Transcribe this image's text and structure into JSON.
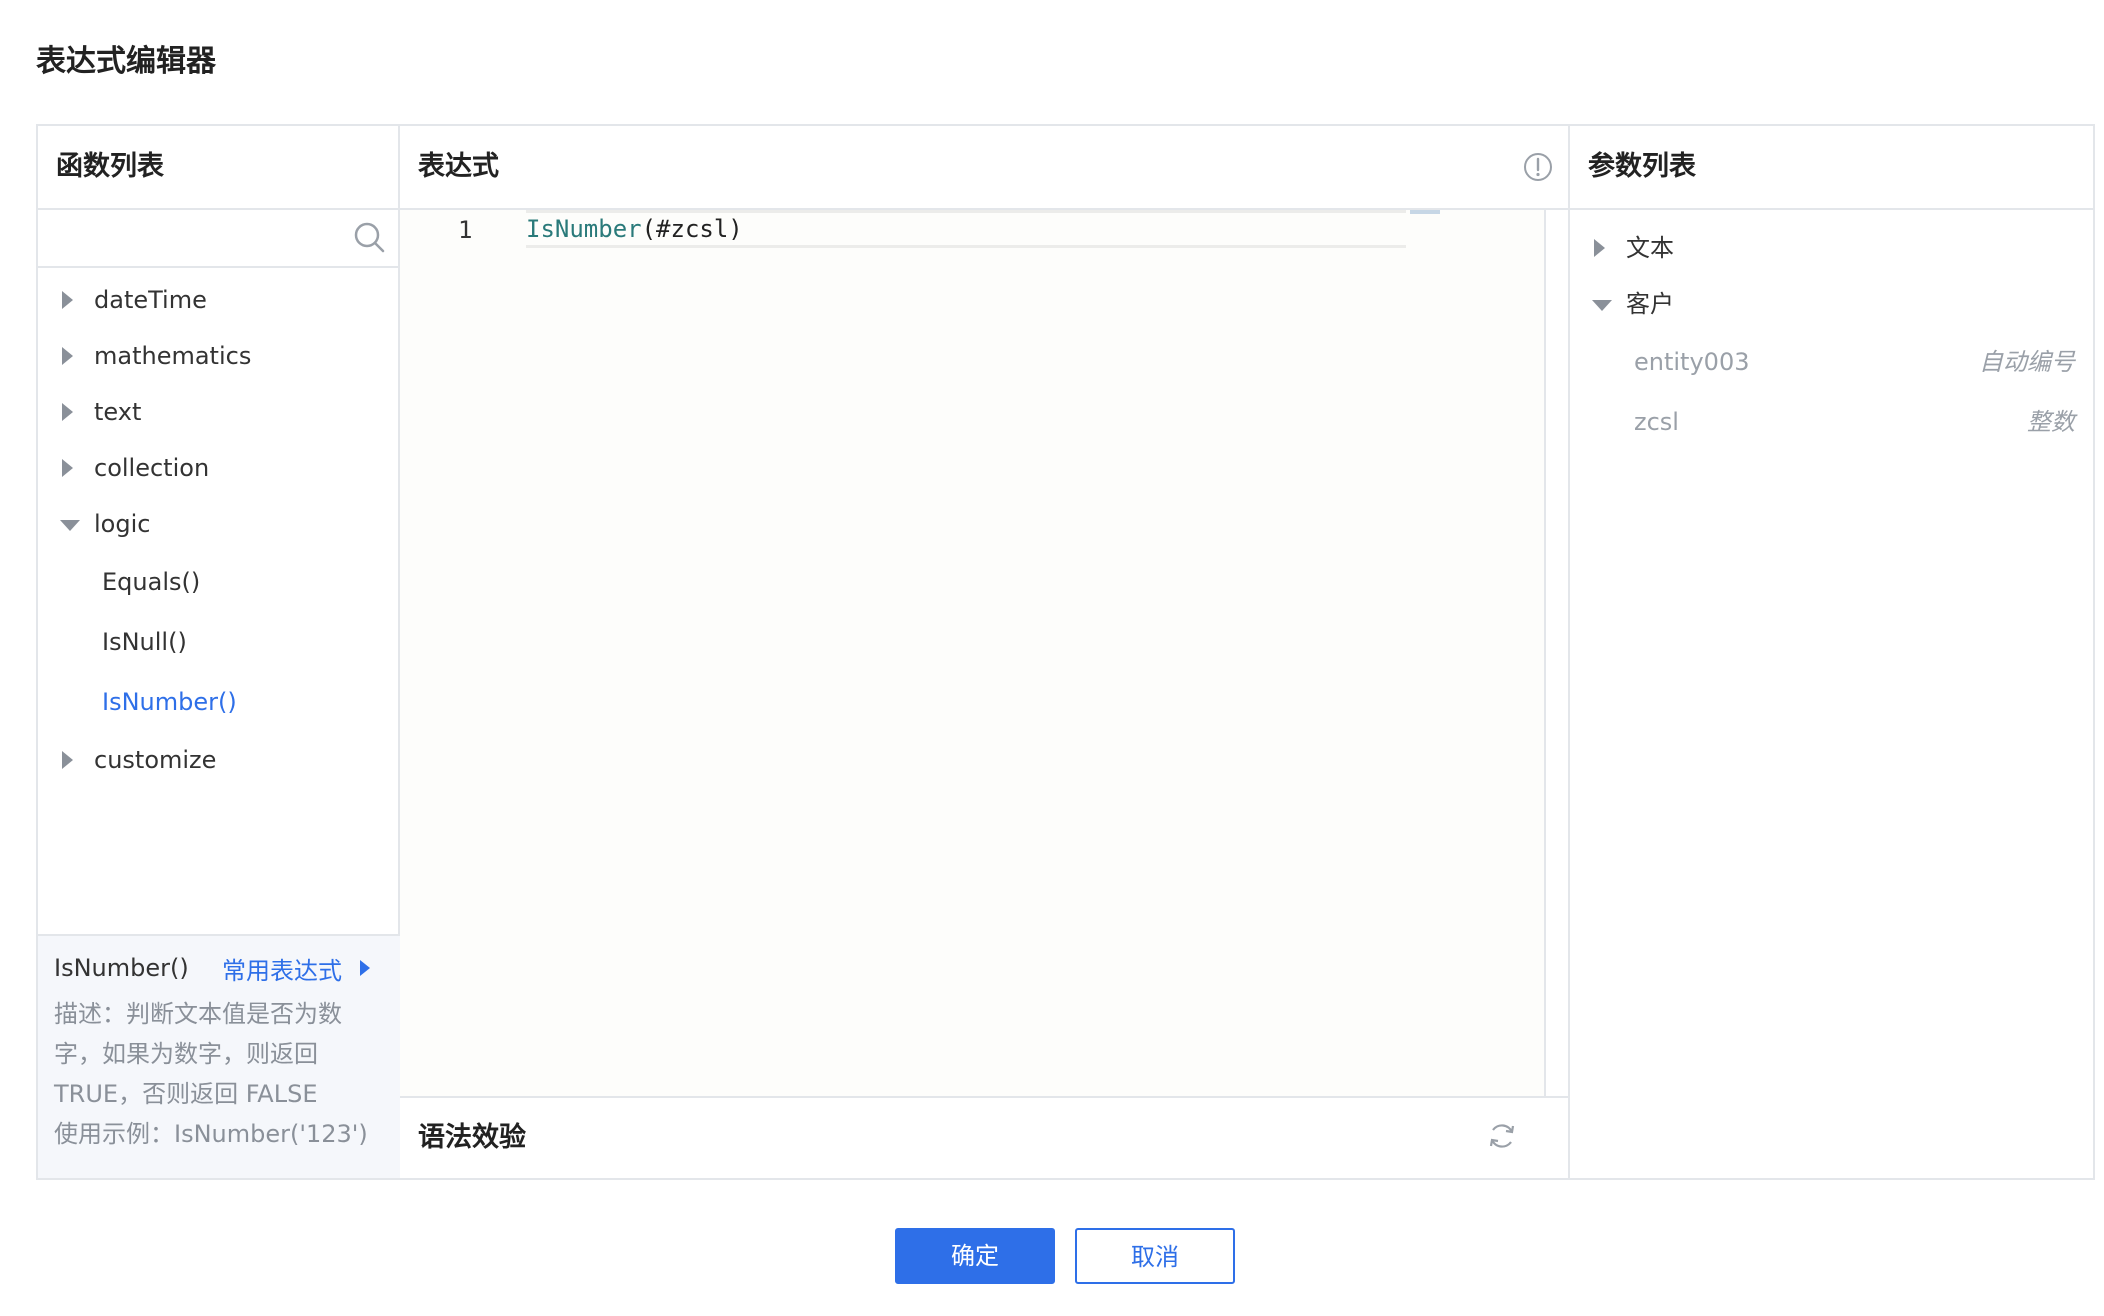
{
  "dialog": {
    "title": "表达式编辑器"
  },
  "functions_panel": {
    "title": "函数列表",
    "search": {
      "value": "",
      "placeholder": ""
    },
    "categories": [
      {
        "label": "dateTime",
        "expanded": false
      },
      {
        "label": "mathematics",
        "expanded": false
      },
      {
        "label": "text",
        "expanded": false
      },
      {
        "label": "collection",
        "expanded": false
      },
      {
        "label": "logic",
        "expanded": true,
        "children": [
          "Equals()",
          "IsNull()",
          "IsNumber()"
        ],
        "active_child": "IsNumber()"
      },
      {
        "label": "customize",
        "expanded": false
      }
    ],
    "description": {
      "function": "IsNumber()",
      "common_link": "常用表达式",
      "lines": [
        "描述：判断文本值是否为数",
        "字，如果为数字，则返回",
        "TRUE，否则返回 FALSE",
        "使用示例：IsNumber('123')"
      ]
    }
  },
  "expression_panel": {
    "title": "表达式",
    "info_icon": "info-circle-icon",
    "editor": {
      "line_number": "1",
      "code_function": "IsNumber",
      "code_rest": "(#zcsl)"
    },
    "validation_title": "语法效验",
    "refresh_icon": "refresh-icon"
  },
  "params_panel": {
    "title": "参数列表",
    "groups": [
      {
        "label": "文本",
        "expanded": false
      },
      {
        "label": "客户",
        "expanded": true,
        "fields": [
          {
            "name": "entity003",
            "type": "自动编号"
          },
          {
            "name": "zcsl",
            "type": "整数"
          }
        ]
      }
    ]
  },
  "buttons": {
    "confirm": "确定",
    "cancel": "取消"
  },
  "colors": {
    "accent": "#2e6fe8",
    "border": "#e3e6ea",
    "muted": "#8a9099",
    "code_function": "#2a7a7a"
  }
}
